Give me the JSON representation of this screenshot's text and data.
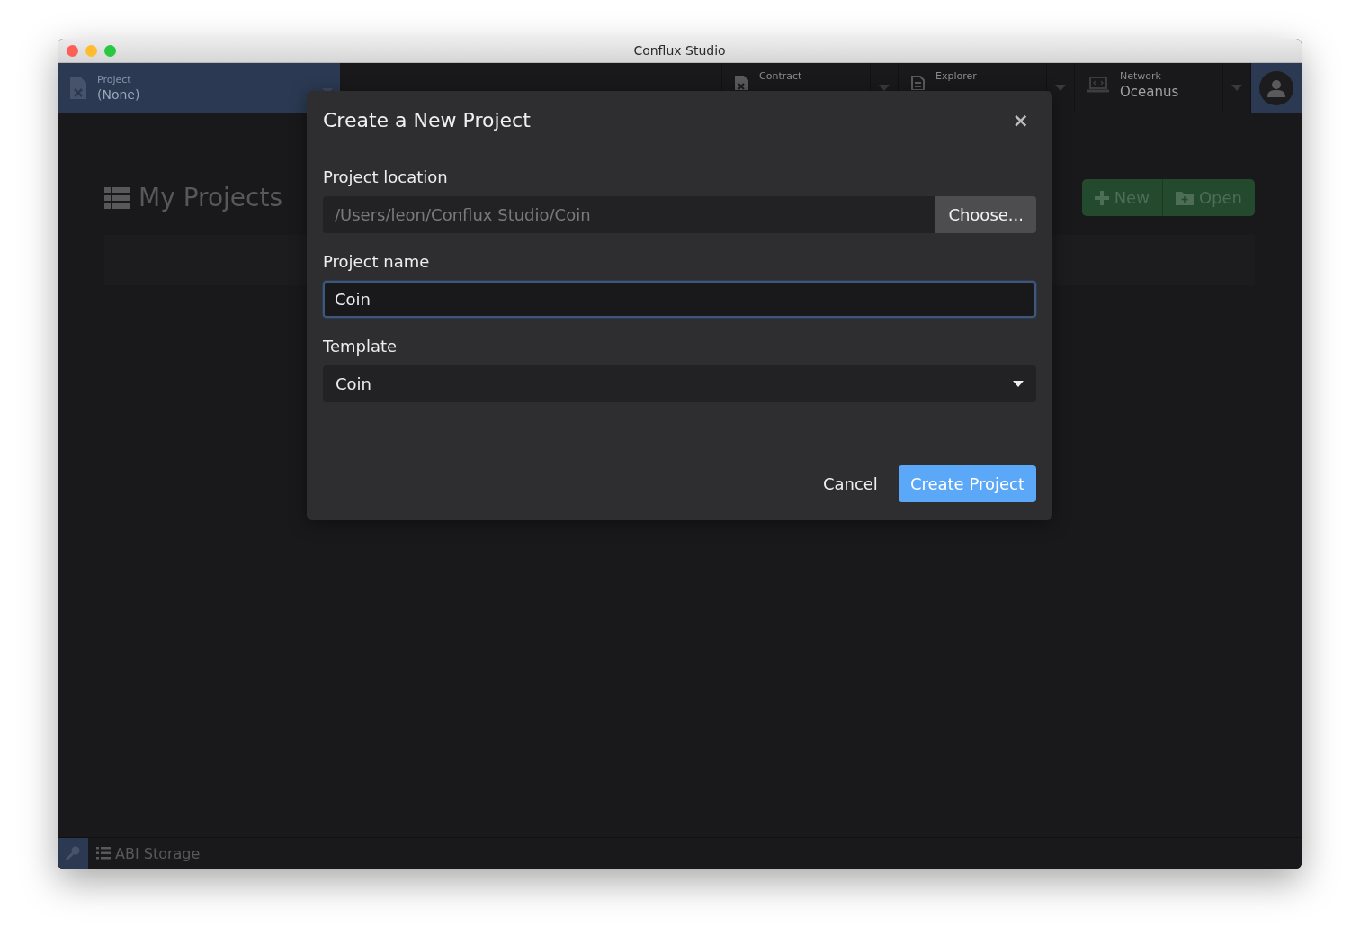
{
  "window": {
    "title": "Conflux Studio"
  },
  "toolbar": {
    "project": {
      "label": "Project",
      "value": "(None)"
    },
    "sections": [
      {
        "label": "Contract",
        "kind": "contract"
      },
      {
        "label": "Explorer",
        "kind": "explorer"
      },
      {
        "label": "Network",
        "value": "Oceanus",
        "kind": "network"
      }
    ]
  },
  "my_projects": {
    "heading": "My Projects",
    "buttons": [
      {
        "label": "New",
        "kind": "new"
      },
      {
        "label": "Open",
        "kind": "open"
      }
    ]
  },
  "status_bar": {
    "label": "ABI Storage"
  },
  "dialog": {
    "title": "Create a New Project",
    "close": "×",
    "fields": [
      {
        "label": "Project location",
        "kind": "path",
        "placeholder": "/Users/leon/Conflux Studio/Coin",
        "button": "Choose...",
        "focused": false
      },
      {
        "label": "Project name",
        "kind": "text",
        "value": "Coin",
        "focused": true
      },
      {
        "label": "Template",
        "kind": "select",
        "value": "Coin",
        "focused": false
      }
    ],
    "buttons": [
      {
        "label": "Cancel",
        "kind": "secondary"
      },
      {
        "label": "Create Project",
        "kind": "primary"
      }
    ]
  }
}
